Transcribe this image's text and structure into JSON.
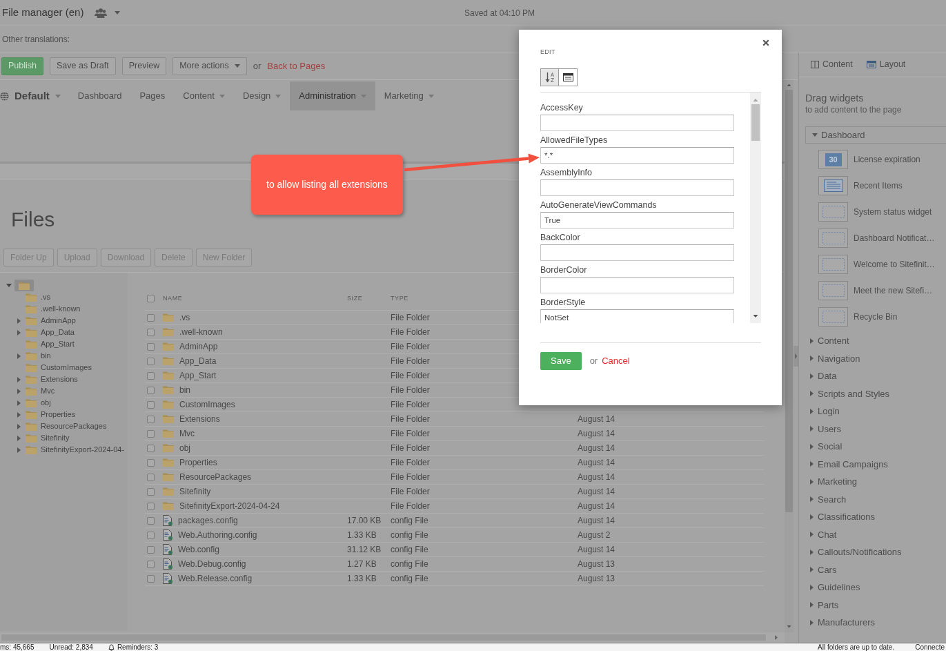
{
  "header": {
    "title": "File manager (en)",
    "saved": "Saved at 04:10 PM"
  },
  "translations": {
    "label": "Other translations:"
  },
  "actions": {
    "buttons": [
      {
        "label": "Publish",
        "kind": "primary"
      },
      {
        "label": "Save as Draft",
        "kind": "plain"
      },
      {
        "label": "Preview",
        "kind": "plain"
      },
      {
        "label": "More actions",
        "kind": "dropdown"
      }
    ],
    "separator": "or",
    "link": "Back to Pages"
  },
  "nav": {
    "site": "Default",
    "items": [
      {
        "label": "Dashboard",
        "dropdown": false,
        "selected": false
      },
      {
        "label": "Pages",
        "dropdown": false,
        "selected": false
      },
      {
        "label": "Content",
        "dropdown": true,
        "selected": false
      },
      {
        "label": "Design",
        "dropdown": true,
        "selected": false
      },
      {
        "label": "Administration",
        "dropdown": true,
        "selected": true
      },
      {
        "label": "Marketing",
        "dropdown": true,
        "selected": false
      }
    ]
  },
  "files": {
    "title": "Files",
    "toolbar": [
      {
        "label": "Folder Up",
        "disabled": true
      },
      {
        "label": "Upload",
        "disabled": true
      },
      {
        "label": "Download",
        "disabled": true
      },
      {
        "label": "Delete",
        "disabled": true
      },
      {
        "label": "New Folder",
        "disabled": true
      }
    ],
    "tree": {
      "expanded": true,
      "selected": true,
      "children": [
        {
          "label": ".vs",
          "expandable": false
        },
        {
          "label": ".well-known",
          "expandable": false
        },
        {
          "label": "AdminApp",
          "expandable": true
        },
        {
          "label": "App_Data",
          "expandable": true
        },
        {
          "label": "App_Start",
          "expandable": false
        },
        {
          "label": "bin",
          "expandable": true
        },
        {
          "label": "CustomImages",
          "expandable": false
        },
        {
          "label": "Extensions",
          "expandable": true
        },
        {
          "label": "Mvc",
          "expandable": true
        },
        {
          "label": "obj",
          "expandable": true
        },
        {
          "label": "Properties",
          "expandable": true
        },
        {
          "label": "ResourcePackages",
          "expandable": true
        },
        {
          "label": "Sitefinity",
          "expandable": true
        },
        {
          "label": "SitefinityExport-2024-04-",
          "expandable": true
        }
      ]
    },
    "table": {
      "columns": [
        "NAME",
        "SIZE",
        "TYPE"
      ],
      "all_checked": false,
      "rows": [
        {
          "name": ".vs",
          "kind": "folder",
          "type": "File Folder",
          "checked": false
        },
        {
          "name": ".well-known",
          "kind": "folder",
          "type": "File Folder",
          "checked": false
        },
        {
          "name": "AdminApp",
          "kind": "folder",
          "type": "File Folder",
          "checked": false
        },
        {
          "name": "App_Data",
          "kind": "folder",
          "type": "File Folder",
          "checked": false
        },
        {
          "name": "App_Start",
          "kind": "folder",
          "type": "File Folder",
          "checked": false
        },
        {
          "name": "bin",
          "kind": "folder",
          "type": "File Folder",
          "checked": false
        },
        {
          "name": "CustomImages",
          "kind": "folder",
          "type": "File Folder",
          "checked": false
        },
        {
          "name": "Extensions",
          "kind": "folder",
          "type": "File Folder",
          "column_4": "August 14",
          "checked": false
        },
        {
          "name": "Mvc",
          "kind": "folder",
          "type": "File Folder",
          "column_4": "August 14",
          "checked": false
        },
        {
          "name": "obj",
          "kind": "folder",
          "type": "File Folder",
          "column_4": "August 14",
          "checked": false
        },
        {
          "name": "Properties",
          "kind": "folder",
          "type": "File Folder",
          "column_4": "August 14",
          "checked": false
        },
        {
          "name": "ResourcePackages",
          "kind": "folder",
          "type": "File Folder",
          "column_4": "August 14",
          "checked": false
        },
        {
          "name": "Sitefinity",
          "kind": "folder",
          "type": "File Folder",
          "column_4": "August 14",
          "checked": false
        },
        {
          "name": "SitefinityExport-2024-04-24",
          "kind": "folder",
          "type": "File Folder",
          "column_4": "August 14",
          "checked": false
        },
        {
          "name": "packages.config",
          "kind": "file",
          "size": "17.00 KB",
          "type": "config File",
          "column_4": "August 14",
          "checked": false
        },
        {
          "name": "Web.Authoring.config",
          "kind": "file",
          "size": "1.33 KB",
          "type": "config File",
          "column_4": "August 2",
          "checked": false
        },
        {
          "name": "Web.config",
          "kind": "file",
          "size": "31.12 KB",
          "type": "config File",
          "column_4": "August 14",
          "checked": false
        },
        {
          "name": "Web.Debug.config",
          "kind": "file",
          "size": "1.27 KB",
          "type": "config File",
          "column_4": "August 13",
          "checked": false
        },
        {
          "name": "Web.Release.config",
          "kind": "file",
          "size": "1.33 KB",
          "type": "config File",
          "column_4": "August 13",
          "checked": false
        }
      ]
    }
  },
  "editor": {
    "title": "EDIT",
    "view_buttons": [
      {
        "kind": "sort",
        "selected": true
      },
      {
        "kind": "list",
        "selected": false
      }
    ],
    "fields": [
      {
        "label": "AccessKey"
      },
      {
        "label": "AllowedFileTypes",
        "value": "*.*"
      },
      {
        "label": "AssemblyInfo"
      },
      {
        "label": "AutoGenerateViewCommands",
        "value": "True"
      },
      {
        "label": "BackColor"
      },
      {
        "label": "BorderColor"
      },
      {
        "label": "BorderStyle",
        "value": "NotSet"
      }
    ],
    "save": "Save",
    "separator": "or",
    "cancel": "Cancel"
  },
  "callout": {
    "text": "to allow listing all extensions"
  },
  "sidebar": {
    "tabs": [
      {
        "label": "Content",
        "kind": "columns"
      },
      {
        "label": "Layout",
        "kind": "layout"
      }
    ],
    "title": "Drag widgets",
    "subtitle": "to add content to the page",
    "groups": [
      {
        "label": "Dashboard",
        "expanded": true,
        "widgets": [
          {
            "label": "License expiration",
            "kind": "calendar",
            "date": "30"
          },
          {
            "label": "Recent Items",
            "kind": "list"
          },
          {
            "label": "System status widget",
            "kind": "blank"
          },
          {
            "label": "Dashboard Notificat…",
            "kind": "blank"
          },
          {
            "label": "Welcome to Sitefinit…",
            "kind": "blank"
          },
          {
            "label": "Meet the new Sitefi…",
            "kind": "blank"
          },
          {
            "label": "Recycle Bin",
            "kind": "blank"
          }
        ]
      },
      {
        "label": "Content",
        "expanded": false
      },
      {
        "label": "Navigation",
        "expanded": false
      },
      {
        "label": "Data",
        "expanded": false
      },
      {
        "label": "Scripts and Styles",
        "expanded": false
      },
      {
        "label": "Login",
        "expanded": false
      },
      {
        "label": "Users",
        "expanded": false
      },
      {
        "label": "Social",
        "expanded": false
      },
      {
        "label": "Email Campaigns",
        "expanded": false
      },
      {
        "label": "Marketing",
        "expanded": false
      },
      {
        "label": "Search",
        "expanded": false
      },
      {
        "label": "Classifications",
        "expanded": false
      },
      {
        "label": "Chat",
        "expanded": false
      },
      {
        "label": "Callouts/Notifications",
        "expanded": false
      },
      {
        "label": "Cars",
        "expanded": false
      },
      {
        "label": "Guidelines",
        "expanded": false
      },
      {
        "label": "Parts",
        "expanded": false
      },
      {
        "label": "Manufacturers",
        "expanded": false
      }
    ]
  },
  "status_bar": {
    "left": [
      {
        "text": "ms: 45,665",
        "kind": "plain"
      },
      {
        "text": "Unread: 2,834",
        "kind": "plain"
      },
      {
        "text": "Reminders: 3",
        "kind": "reminders"
      }
    ],
    "right": [
      {
        "text": "All folders are up to date."
      },
      {
        "text": "Connecte"
      }
    ]
  }
}
